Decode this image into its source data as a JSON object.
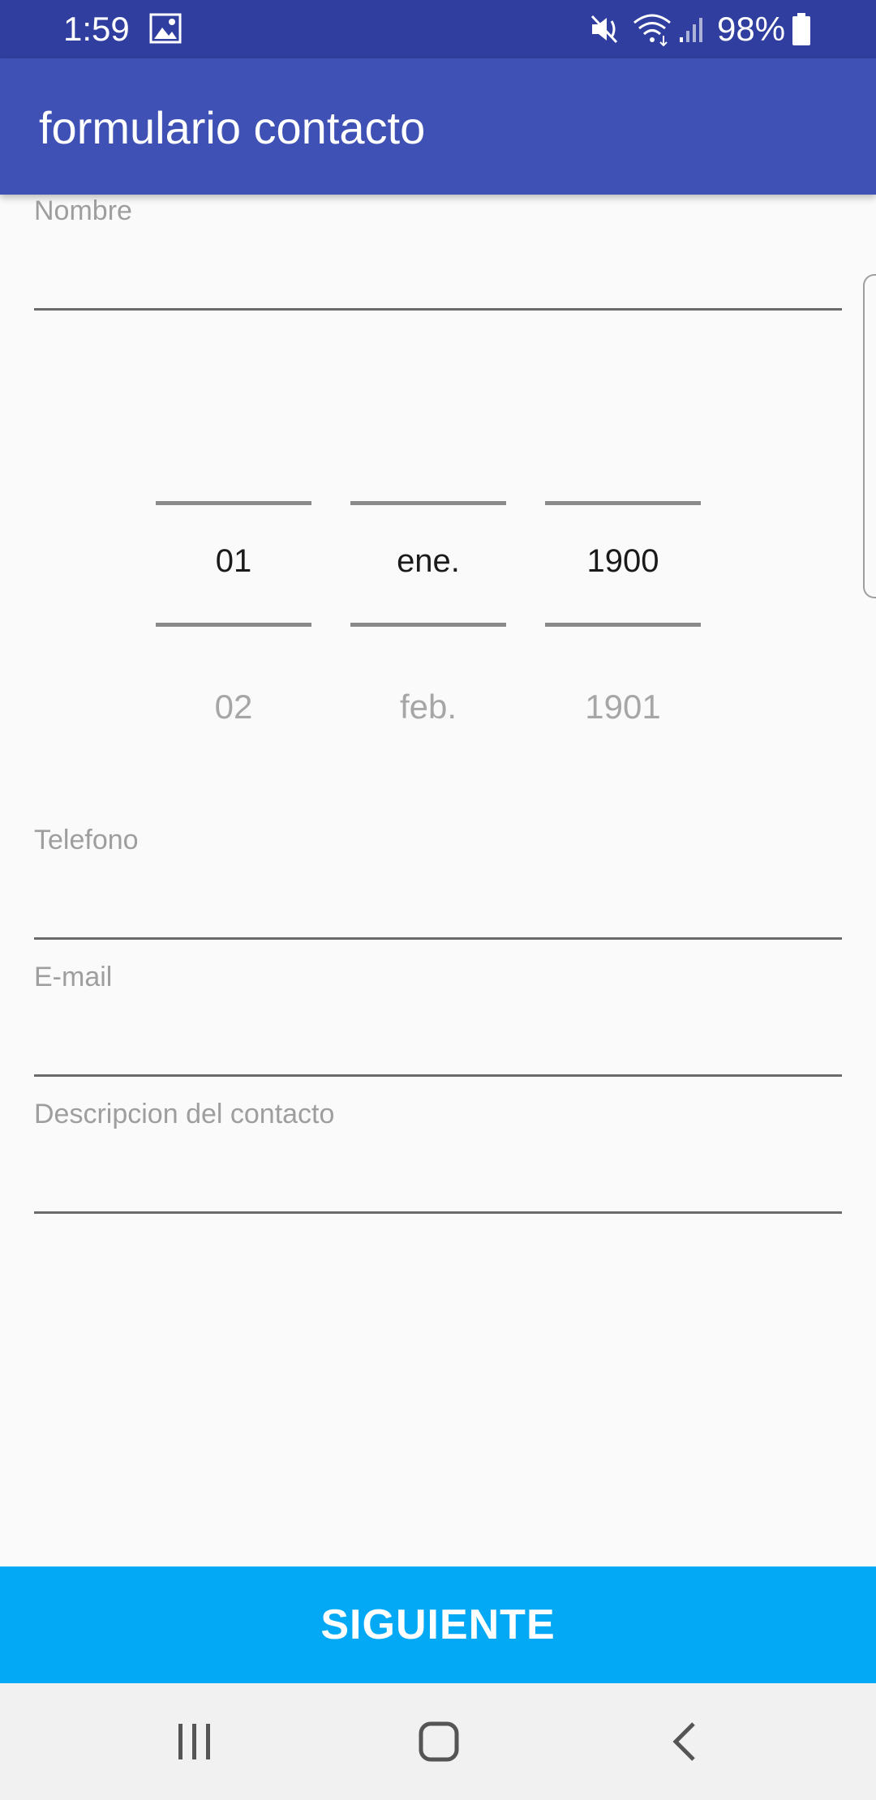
{
  "status_bar": {
    "time": "1:59",
    "battery": "98%",
    "icons": [
      "image-icon",
      "mute-icon",
      "wifi-icon",
      "signal-icon",
      "battery-icon"
    ]
  },
  "app_bar": {
    "title": "formulario contacto"
  },
  "form": {
    "nombre_label": "Nombre",
    "date_picker": {
      "day_selected": "01",
      "month_selected": "ene.",
      "year_selected": "1900",
      "day_next": "02",
      "month_next": "feb.",
      "year_next": "1901"
    },
    "telefono_label": "Telefono",
    "email_label": "E-mail",
    "descripcion_label": "Descripcion del contacto"
  },
  "actions": {
    "next_label": "SIGUIENTE"
  },
  "nav_bar": {
    "icons": [
      "recents-icon",
      "home-icon",
      "back-icon"
    ]
  },
  "colors": {
    "status_bar": "#303f9f",
    "app_bar": "#3f51b5",
    "accent_button": "#03a9f4",
    "background": "#fafafa"
  }
}
